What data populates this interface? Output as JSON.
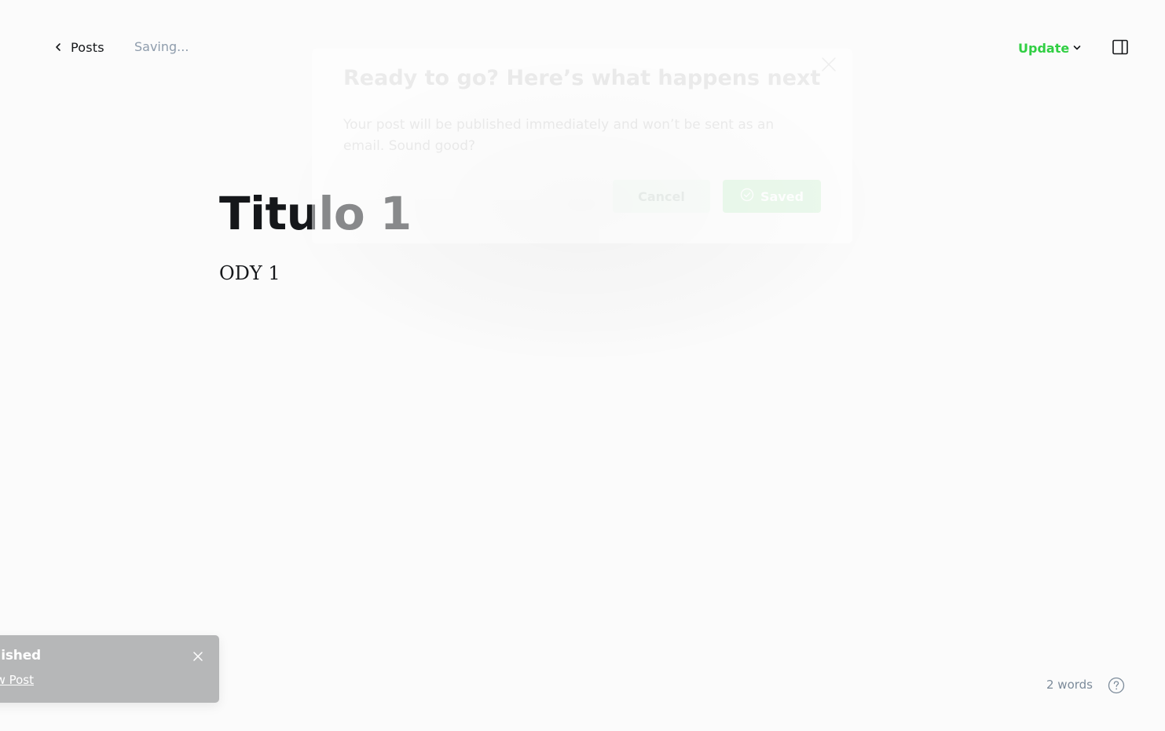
{
  "header": {
    "back_label": "Posts",
    "status": "Saving...",
    "update_label": "Update",
    "icons": {
      "back": "chevron-left-icon",
      "update": "chevron-down-icon",
      "sidebar": "sidebar-toggle-icon"
    },
    "accent_color": "#30cf43"
  },
  "editor": {
    "title": "Titulo 1",
    "body": "ODY 1"
  },
  "modal": {
    "title": "Ready to go? Here’s what happens next",
    "message": "Your post will be published immediately and won’t be sent as an email. Sound good?",
    "cancel_label": "Cancel",
    "confirm_label": "Saved",
    "icons": {
      "close": "close-icon",
      "confirm": "check-circle-icon"
    }
  },
  "toast": {
    "title": "blished",
    "link": "w Post",
    "icons": {
      "close": "close-icon"
    }
  },
  "footer": {
    "word_count": "2 words",
    "icons": {
      "help": "help-circle-icon"
    }
  }
}
